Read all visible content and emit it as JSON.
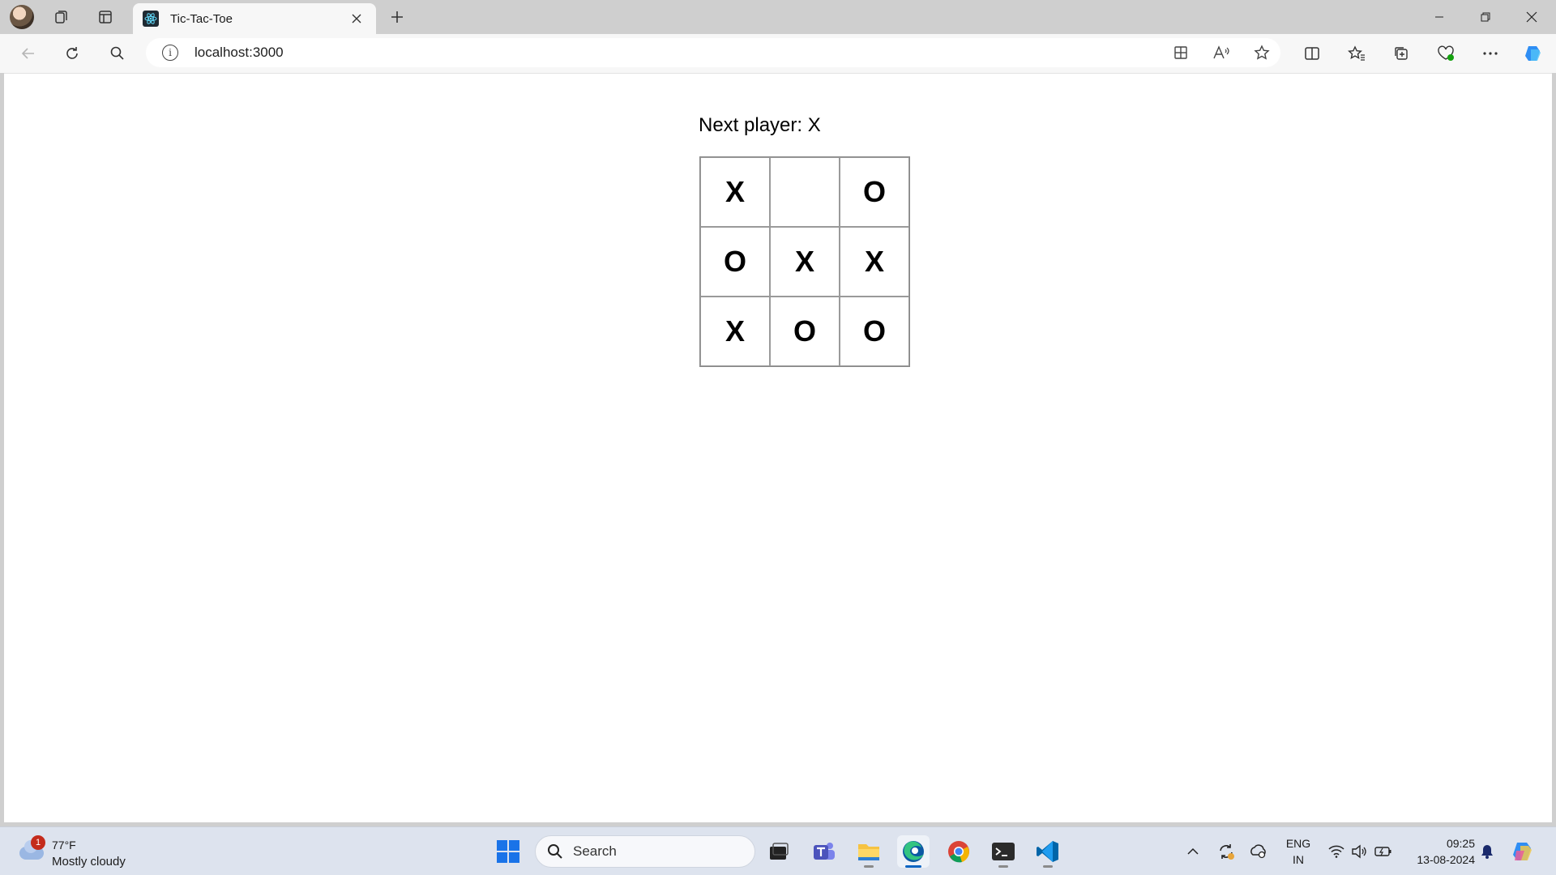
{
  "browser": {
    "tab_title": "Tic-Tac-Toe",
    "url": "localhost:3000"
  },
  "game": {
    "status": "Next player: X",
    "squares": [
      "X",
      "",
      "O",
      "O",
      "X",
      "X",
      "X",
      "O",
      "O"
    ]
  },
  "taskbar": {
    "weather": {
      "badge": "1",
      "temp": "77°F",
      "desc": "Mostly cloudy"
    },
    "search_label": "Search",
    "language": {
      "line1": "ENG",
      "line2": "IN"
    },
    "clock": {
      "time": "09:25",
      "date": "13-08-2024"
    }
  },
  "colors": {
    "accent": "#0a64c2",
    "board_border": "#9a9a9a"
  }
}
